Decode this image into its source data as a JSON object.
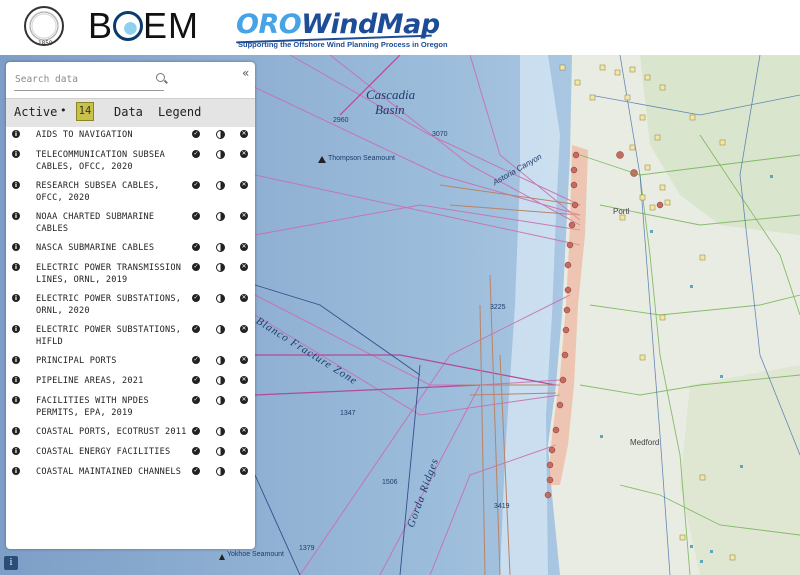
{
  "header": {
    "seal_year": "1859",
    "boem_prefix": "B",
    "boem_suffix": "EM",
    "oro_prefix": "ORO",
    "oro_main": "WindMap",
    "oro_subtitle": "Supporting the Offshore Wind Planning Process in Oregon"
  },
  "map": {
    "labels": {
      "cascadia_line1": "Cascadia",
      "cascadia_line2": "Basin",
      "astoria": "Astoria Canyon",
      "thompson": "Thompson Seamount",
      "blanco": "Blanco Fracture Zone",
      "gorda": "Gorda Ridges",
      "yokhoe": "Yokhoe Seamount",
      "depth_2960": "2960",
      "depth_3070": "3070",
      "depth_3225": "3225",
      "depth_1347": "1347",
      "depth_1506": "1506",
      "depth_3419": "3419",
      "depth_1379": "1379",
      "land_portland": "Portl",
      "land_medford": "Medford"
    }
  },
  "panel": {
    "search_placeholder": "Search data",
    "collapse_glyph": "«",
    "tabs": {
      "active": "Active",
      "dot": "•",
      "count": "14",
      "data": "Data",
      "legend": "Legend"
    },
    "layers": [
      {
        "name": "AIDS TO NAVIGATION"
      },
      {
        "name": "TELECOMMUNICATION SUBSEA CABLES, OFCC, 2020"
      },
      {
        "name": "RESEARCH SUBSEA CABLES, OFCC, 2020"
      },
      {
        "name": "NOAA CHARTED SUBMARINE CABLES"
      },
      {
        "name": "NASCA SUBMARINE CABLES"
      },
      {
        "name": "ELECTRIC POWER TRANSMISSION LINES, ORNL, 2019"
      },
      {
        "name": "ELECTRIC POWER SUBSTATIONS, ORNL, 2020"
      },
      {
        "name": "ELECTRIC POWER SUBSTATIONS, HIFLD"
      },
      {
        "name": "PRINCIPAL PORTS"
      },
      {
        "name": "PIPELINE AREAS, 2021"
      },
      {
        "name": "FACILITIES WITH NPDES PERMITS, EPA, 2019"
      },
      {
        "name": "COASTAL PORTS, ECOTRUST 2011"
      },
      {
        "name": "COASTAL ENERGY FACILITIES"
      },
      {
        "name": "COASTAL MAINTAINED CHANNELS"
      }
    ]
  },
  "footer": {
    "info_glyph": "i"
  }
}
